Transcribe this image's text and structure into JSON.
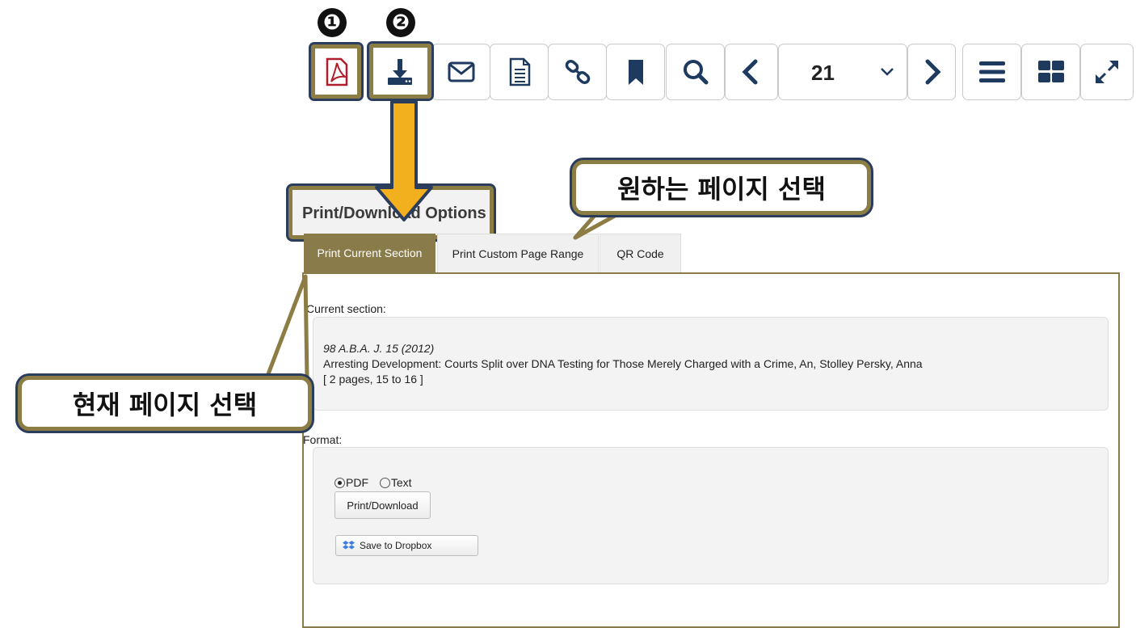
{
  "markers": [
    "❶",
    "❷"
  ],
  "toolbar": {
    "buttons": [
      {
        "name": "pdf-icon",
        "highlighted": true
      },
      {
        "name": "download-icon",
        "highlighted": true
      },
      {
        "name": "mail-icon"
      },
      {
        "name": "document-icon"
      },
      {
        "name": "link-icon"
      },
      {
        "name": "bookmark-icon"
      },
      {
        "name": "search-icon"
      },
      {
        "name": "chevron-left-icon"
      },
      {
        "name": "chevron-right-icon"
      },
      {
        "name": "menu-icon"
      },
      {
        "name": "grid-icon"
      },
      {
        "name": "expand-icon"
      }
    ],
    "page_value": "21"
  },
  "dialog": {
    "title": "Print/Download Options",
    "tabs": [
      "Print Current Section",
      "Print Custom Page Range",
      "QR Code"
    ],
    "active_tab": "Print Current Section",
    "current_section_label": "Current section:",
    "citation": "98 A.B.A. J. 15 (2012)",
    "article": "Arresting Development: Courts Split over DNA Testing for Those Merely Charged with a Crime, An, Stolley Persky, Anna",
    "pages": "[ 2 pages, 15 to 16 ]",
    "format_label": "Format:",
    "format_options": [
      "PDF",
      "Text"
    ],
    "format_selected": "PDF",
    "print_button": "Print/Download",
    "dropbox_button": "Save to Dropbox"
  },
  "callouts": {
    "select_page": "원하는 페이지 선택",
    "current_page": "현재 페이지 선택"
  },
  "colors": {
    "accent": "#8a7c4a",
    "frame": "#2b3d5c",
    "arrow": "#f2b01e",
    "pdf_red": "#b01e2e",
    "dropbox_blue": "#3d7ee0"
  }
}
